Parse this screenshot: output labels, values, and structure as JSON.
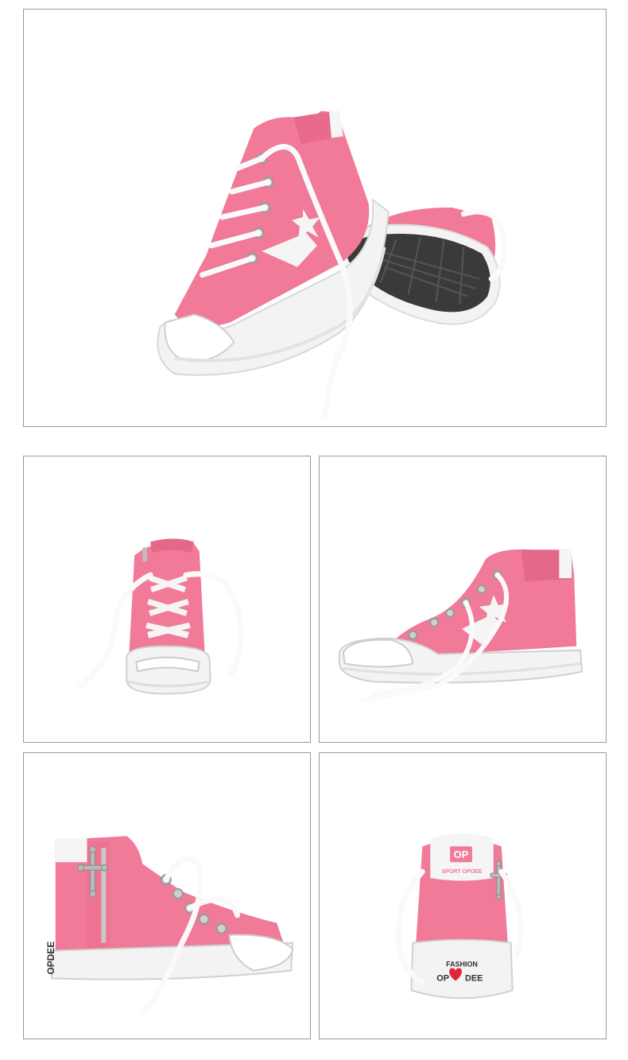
{
  "colors": {
    "canvas_pink": "#f07a98",
    "canvas_pink_light": "#f59bb2",
    "canvas_pink_dark": "#d85a7c",
    "sole_white": "#f3f3f3",
    "lace_white": "#fafafa",
    "outsole_dark": "#3a3a3a",
    "panel_border": "#9a9a9a",
    "heart_red": "#e0253a"
  },
  "panels": [
    {
      "name": "hero-pair-view"
    },
    {
      "name": "front-view"
    },
    {
      "name": "side-view"
    },
    {
      "name": "zipper-side-view"
    },
    {
      "name": "back-view"
    }
  ],
  "back_view": {
    "tab_logo": "OP",
    "tab_text": "SPORT OPOEE",
    "heel_line1": "FASHION",
    "heel_line2_left": "OP",
    "heel_line2_right": "DEE"
  },
  "zipper_view": {
    "heel_brand_text": "OPDEE"
  }
}
